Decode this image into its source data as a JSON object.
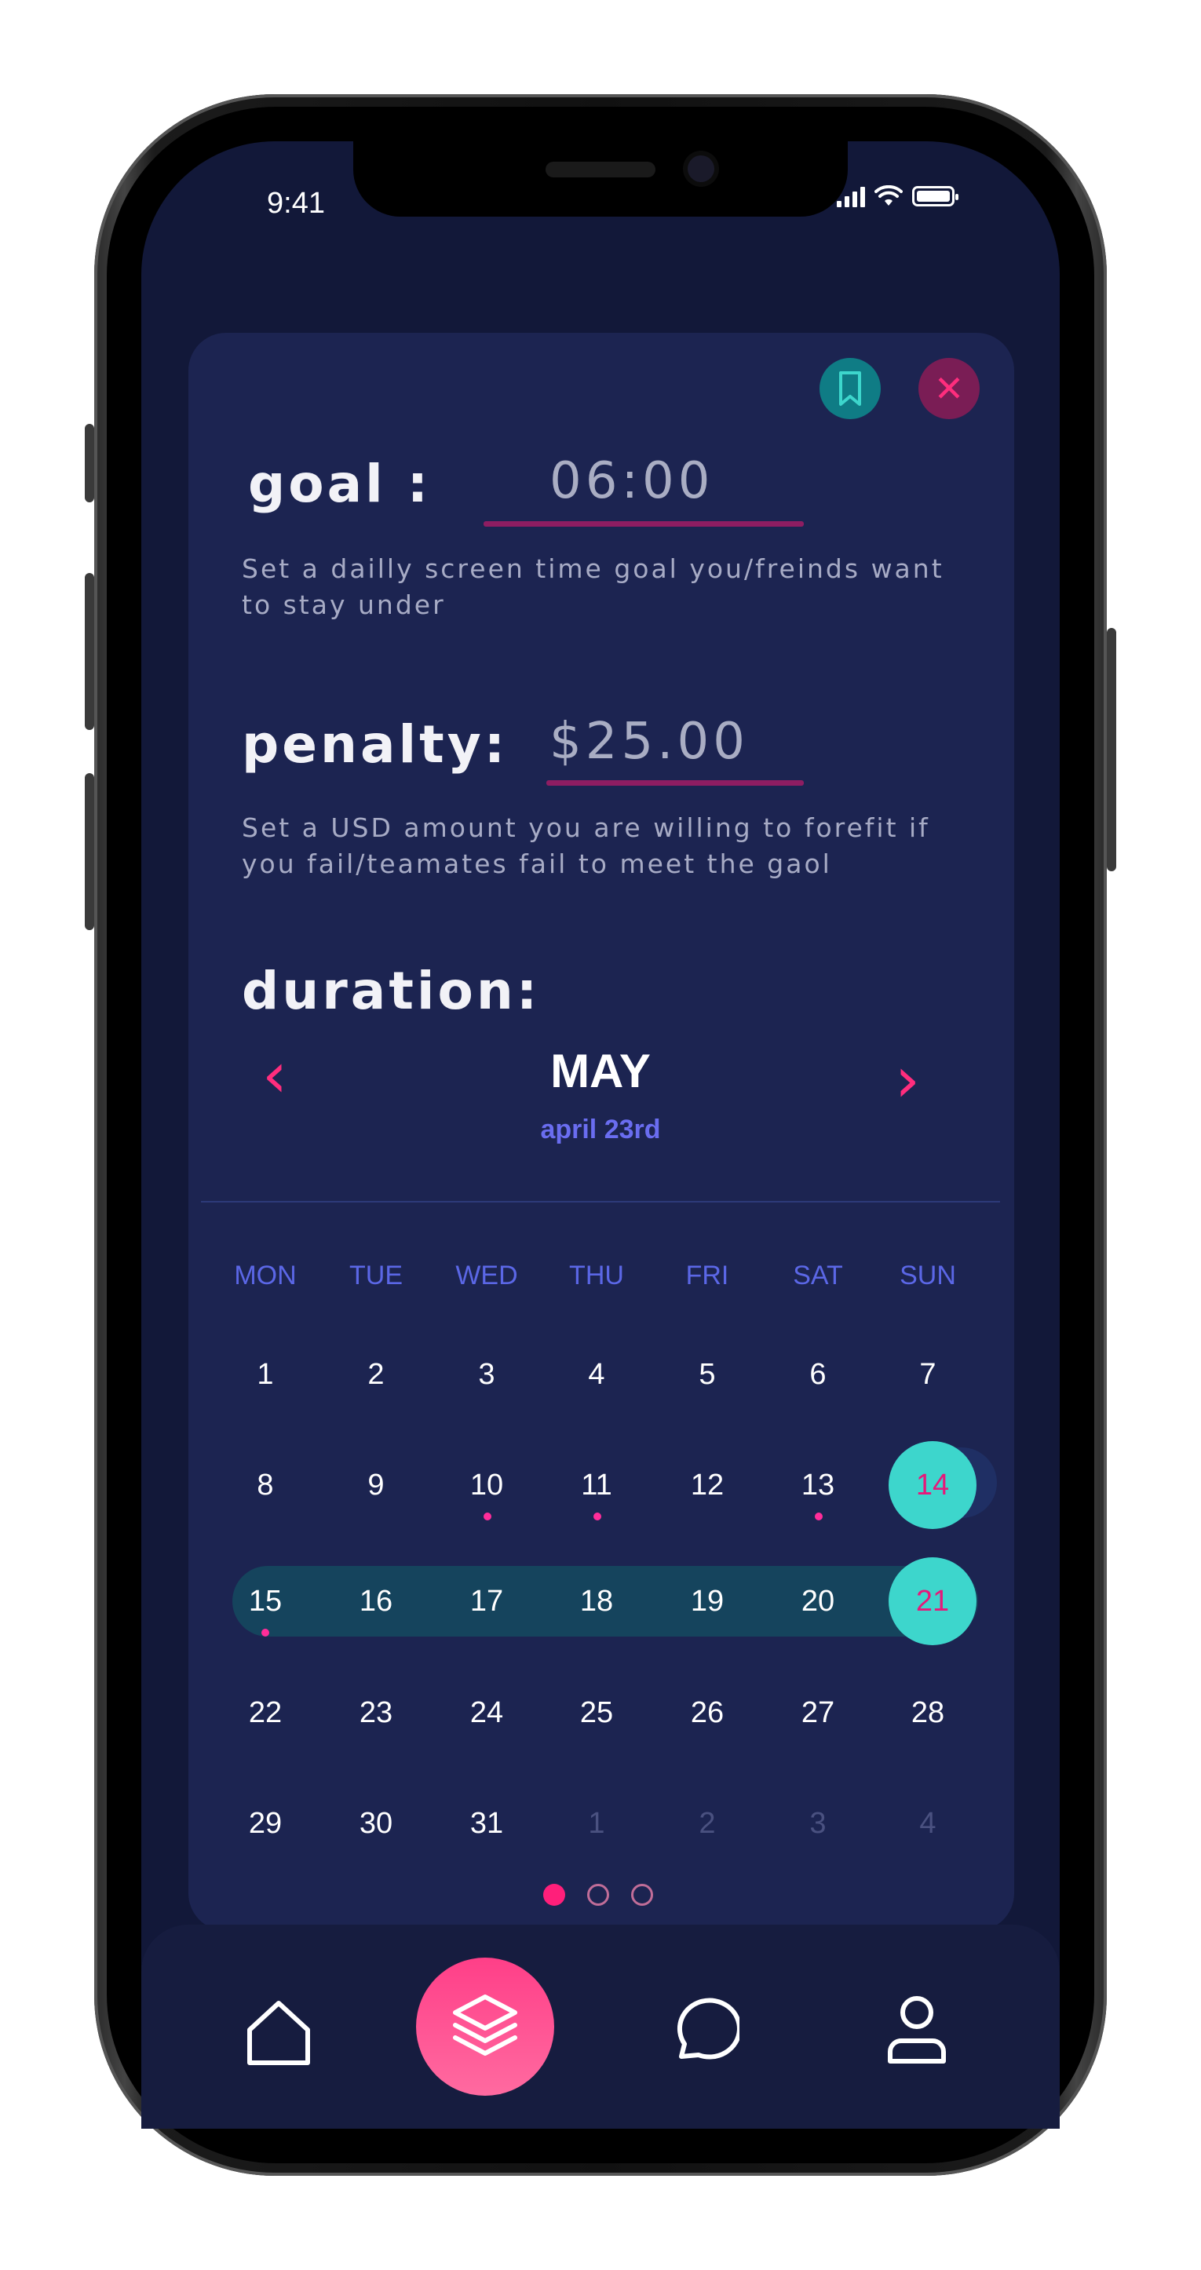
{
  "status_bar": {
    "time": "9:41"
  },
  "header": {
    "bookmark_icon": "bookmark-icon",
    "close_icon": "close-icon",
    "close_glyph": "✕"
  },
  "goal": {
    "label": "goal :",
    "value": "06:00",
    "description": "Set a dailly screen time goal you/freinds want to stay under"
  },
  "penalty": {
    "label": "penalty:",
    "value": "$25.00",
    "description": "Set a USD amount you are willing to forefit if you fail/teamates fail to meet the gaol"
  },
  "duration": {
    "label": "duration:",
    "month": "MAY",
    "subdate": "april 23rd",
    "prev_glyph": "‹",
    "next_glyph": "›"
  },
  "calendar": {
    "weekdays": [
      "MON",
      "TUE",
      "WED",
      "THU",
      "FRI",
      "SAT",
      "SUN"
    ],
    "weeks": [
      [
        "1",
        "2",
        "3",
        "4",
        "5",
        "6",
        "7"
      ],
      [
        "8",
        "9",
        "10",
        "11",
        "12",
        "13",
        "14"
      ],
      [
        "15",
        "16",
        "17",
        "18",
        "19",
        "20",
        "21"
      ],
      [
        "22",
        "23",
        "24",
        "25",
        "26",
        "27",
        "28"
      ],
      [
        "29",
        "30",
        "31",
        "1",
        "2",
        "3",
        "4"
      ]
    ],
    "selected": [
      "14",
      "21"
    ],
    "range": [
      "15",
      "21"
    ],
    "dotted_days": [
      "10",
      "11",
      "13",
      "15"
    ],
    "accent": "#3dd6cc",
    "dot_color": "#ff2d9a"
  },
  "pager": {
    "pages": 3,
    "active_index": 0
  },
  "tab_bar": {
    "items": [
      {
        "name": "home",
        "icon": "home-icon"
      },
      {
        "name": "layers",
        "icon": "layers-icon",
        "active": true
      },
      {
        "name": "chat",
        "icon": "chat-bubble-icon"
      },
      {
        "name": "profile",
        "icon": "user-icon"
      }
    ],
    "accent": "#ff3f88"
  }
}
